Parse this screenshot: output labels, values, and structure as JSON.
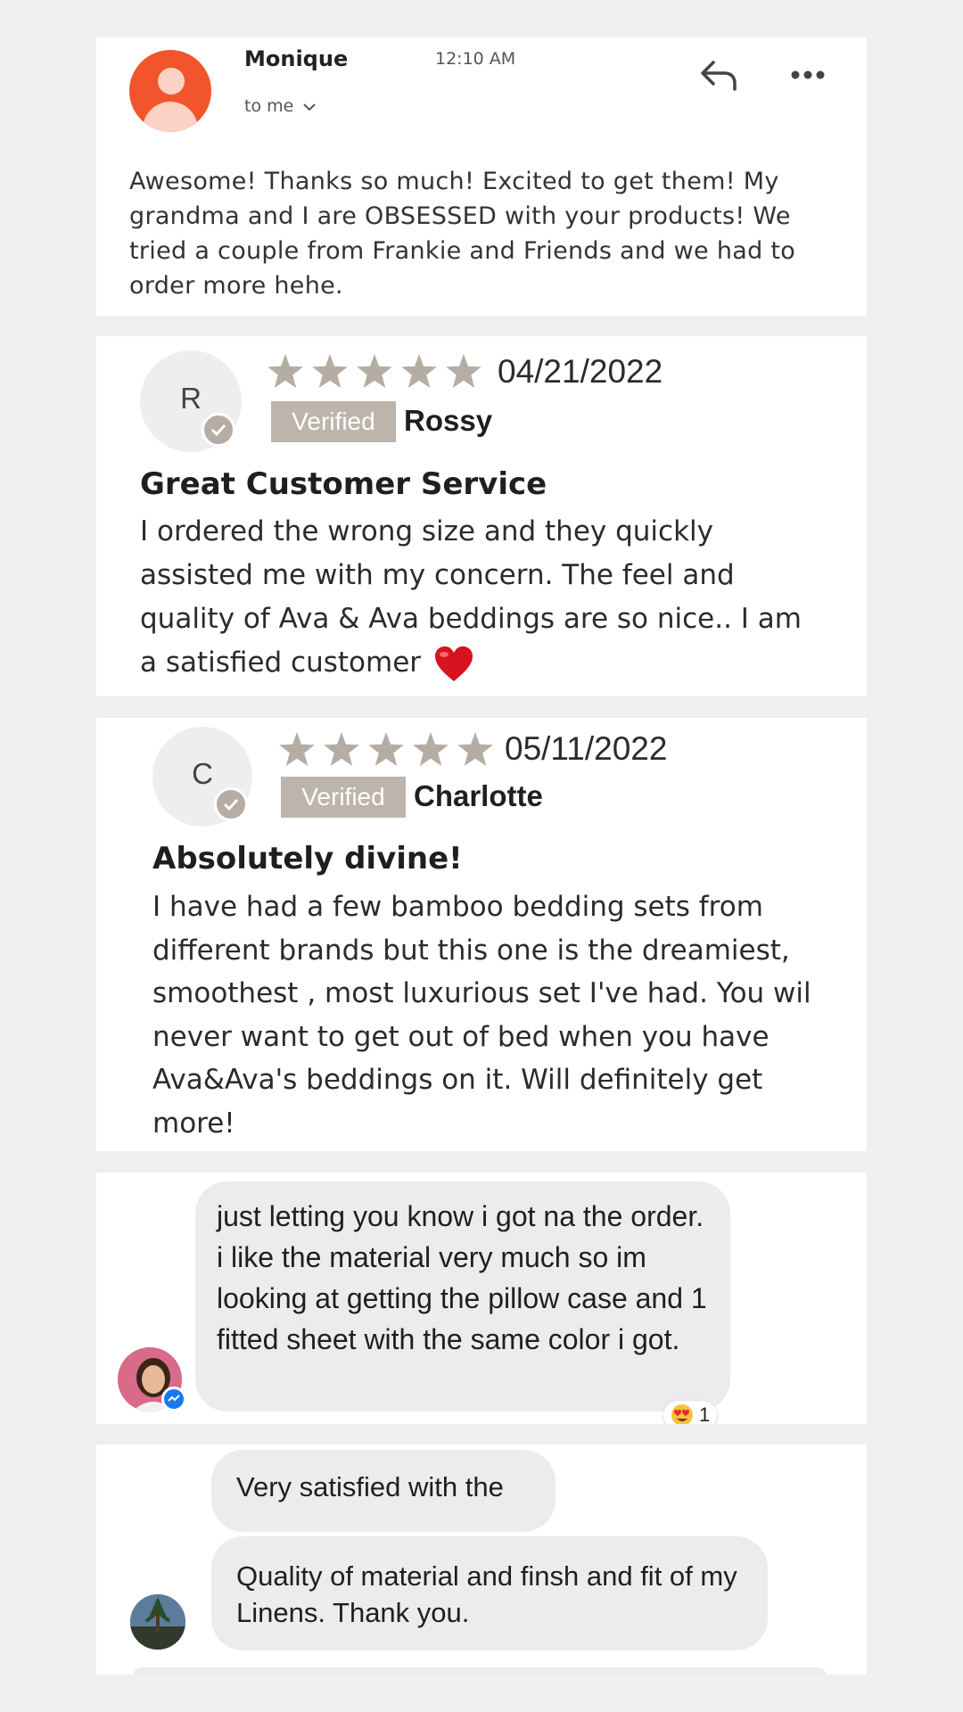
{
  "email": {
    "sender": "Monique",
    "time": "12:10 AM",
    "recipient": "to me",
    "body": "Awesome! Thanks so much! Excited to get them! My grandma and I are OBSESSED with your products! We tried a couple from Frankie and Friends and we had to order more hehe.",
    "avatar_color": "#f2552b",
    "icons": [
      "reply-icon",
      "more-icon",
      "chevron-down-icon"
    ]
  },
  "reviews": [
    {
      "initial": "R",
      "rating": 5,
      "date": "04/21/2022",
      "badge": "Verified",
      "name": "Rossy",
      "title": "Great Customer Service",
      "text": "I ordered the wrong size and they quickly assisted me with my concern. The feel and quality of Ava & Ava beddings are so nice.. I am a satisfied customer",
      "emoji": "heart-icon"
    },
    {
      "initial": "C",
      "rating": 5,
      "date": "05/11/2022",
      "badge": "Verified",
      "name": "Charlotte",
      "title": "Absolutely divine!",
      "text": "I have had a few bamboo bedding sets from different brands but this one is the dreamiest, smoothest , most luxurious set I've had. You wil never want to get out of bed when you have Ava&Ava's beddings on it. Will definitely get more!"
    }
  ],
  "chats": [
    {
      "messages": [
        "just letting you know i got na the order.  i like the material very much so im looking at getting the pillow case and 1 fitted sheet with the same color i got."
      ],
      "reaction_emoji": "heart-eyes-emoji-icon",
      "reaction_count": "1"
    },
    {
      "messages": [
        "Very satisfied with the",
        "Quality of material and finsh and fit of my Linens. Thank you."
      ]
    }
  ],
  "colors": {
    "page_bg": "#efefef",
    "star": "#b5aca3",
    "verified_bg": "#bdb4ab",
    "bubble_bg": "#ececec",
    "messenger_blue": "#1877f2"
  }
}
